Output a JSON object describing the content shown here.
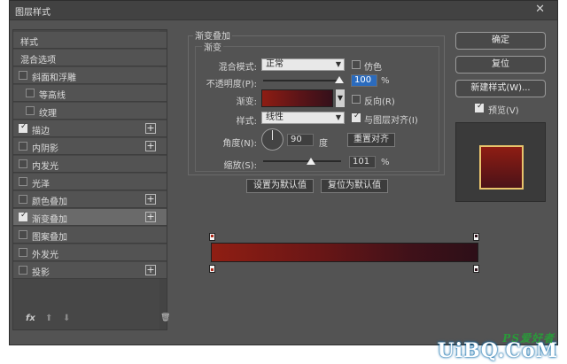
{
  "window": {
    "title": "图层样式",
    "close": "✕"
  },
  "left_panel": {
    "items": [
      {
        "label": "样式",
        "checkbox": false,
        "checked": false,
        "plus": false,
        "selected": false
      },
      {
        "label": "混合选项",
        "checkbox": false,
        "checked": false,
        "plus": false,
        "selected": false
      },
      {
        "label": "斜面和浮雕",
        "checkbox": true,
        "checked": false,
        "plus": false,
        "selected": false
      },
      {
        "label": "等高线",
        "checkbox": true,
        "checked": false,
        "plus": false,
        "selected": false,
        "indent": true
      },
      {
        "label": "纹理",
        "checkbox": true,
        "checked": false,
        "plus": false,
        "selected": false,
        "indent": true
      },
      {
        "label": "描边",
        "checkbox": true,
        "checked": true,
        "plus": true,
        "selected": false
      },
      {
        "label": "内阴影",
        "checkbox": true,
        "checked": false,
        "plus": true,
        "selected": false
      },
      {
        "label": "内发光",
        "checkbox": true,
        "checked": false,
        "plus": false,
        "selected": false
      },
      {
        "label": "光泽",
        "checkbox": true,
        "checked": false,
        "plus": false,
        "selected": false
      },
      {
        "label": "颜色叠加",
        "checkbox": true,
        "checked": false,
        "plus": true,
        "selected": false
      },
      {
        "label": "渐变叠加",
        "checkbox": true,
        "checked": true,
        "plus": true,
        "selected": true
      },
      {
        "label": "图案叠加",
        "checkbox": true,
        "checked": false,
        "plus": false,
        "selected": false
      },
      {
        "label": "外发光",
        "checkbox": true,
        "checked": false,
        "plus": false,
        "selected": false
      },
      {
        "label": "投影",
        "checkbox": true,
        "checked": false,
        "plus": true,
        "selected": false
      }
    ],
    "footer": {
      "fx": "fx",
      "up": "⬆",
      "down": "⬇",
      "trash": "🗑"
    }
  },
  "gradient_overlay": {
    "group_title": "渐变叠加",
    "inner_title": "渐变",
    "blend_mode_label": "混合模式:",
    "blend_mode_value": "正常",
    "dither_label": "仿色",
    "opacity_label": "不透明度(P):",
    "opacity_value": "100",
    "opacity_unit": "%",
    "gradient_label": "渐变:",
    "reverse_label": "反向(R)",
    "style_label": "样式:",
    "style_value": "线性",
    "align_label": "与图层对齐(I)",
    "angle_label": "角度(N):",
    "angle_value": "90",
    "angle_unit": "度",
    "reset_align_button": "重置对齐",
    "scale_label": "缩放(S):",
    "scale_value": "101",
    "scale_unit": "%",
    "make_default_button": "设置为默认值",
    "reset_default_button": "复位为默认值"
  },
  "right_buttons": {
    "ok": "确定",
    "reset": "复位",
    "new_style": "新建样式(W)...",
    "preview_label": "预览(V)"
  },
  "colors": {
    "gradient_start": "#8f1e13",
    "gradient_end": "#2d0f18",
    "preview_border": "#e9c46c"
  },
  "watermark": {
    "text": "UiBQ.CoM",
    "sub": "PS爱好者"
  }
}
